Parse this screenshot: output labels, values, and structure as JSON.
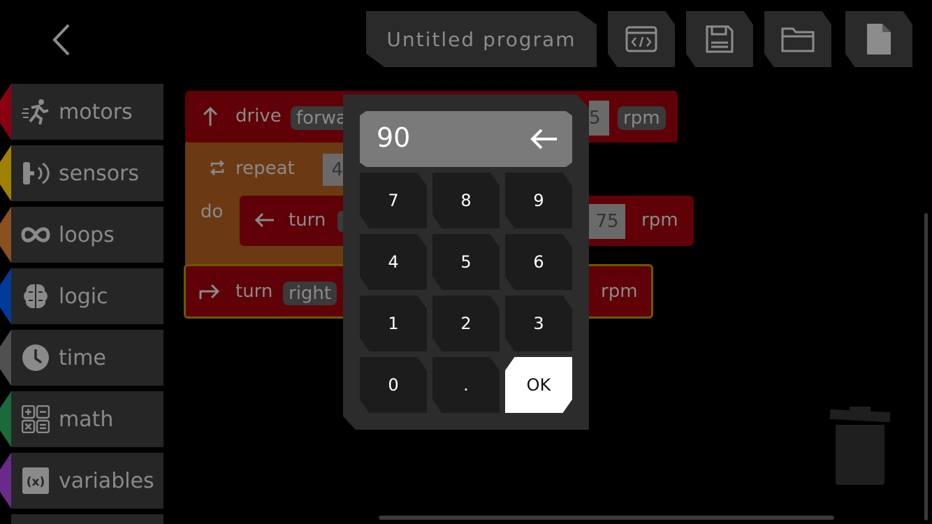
{
  "header": {
    "program_title": "Untitled program",
    "buttons": [
      "code-view",
      "save",
      "open-folder",
      "new-file"
    ]
  },
  "sidebar": {
    "categories": [
      {
        "label": "motors",
        "icon": "runner-icon",
        "color": "#8a0010"
      },
      {
        "label": "sensors",
        "icon": "sensor-icon",
        "color": "#a08000"
      },
      {
        "label": "loops",
        "icon": "infinity-icon",
        "color": "#8a5020"
      },
      {
        "label": "logic",
        "icon": "brain-icon",
        "color": "#003a9a"
      },
      {
        "label": "time",
        "icon": "clock-icon",
        "color": "#505050"
      },
      {
        "label": "math",
        "icon": "calculator-icon",
        "color": "#1a6a3a"
      },
      {
        "label": "variables",
        "icon": "variable-icon",
        "color": "#6a2a8a"
      }
    ]
  },
  "workspace": {
    "block1": {
      "verb": "drive",
      "direction": "forwa",
      "value": "5",
      "unit": "rpm"
    },
    "block2": {
      "verb": "repeat",
      "count": "4",
      "do": "do"
    },
    "block3": {
      "verb": "turn",
      "value": "75",
      "unit": "rpm"
    },
    "block4": {
      "verb": "turn",
      "direction": "right",
      "unit": "rpm"
    }
  },
  "keypad": {
    "display_value": "90",
    "keys": [
      "7",
      "8",
      "9",
      "4",
      "5",
      "6",
      "1",
      "2",
      "3",
      "0",
      "."
    ],
    "ok_label": "OK"
  }
}
